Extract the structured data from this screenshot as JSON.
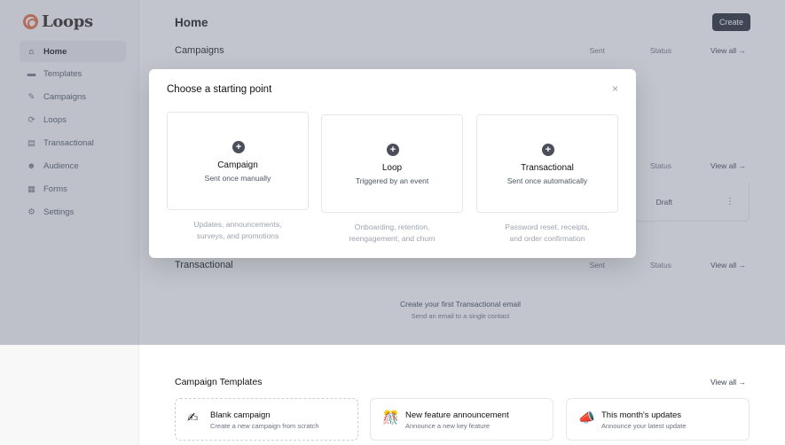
{
  "app": {
    "name": "Loops"
  },
  "sidebar": {
    "items": [
      {
        "label": "Home",
        "icon": "home-icon",
        "glyph": "⌂"
      },
      {
        "label": "Templates",
        "icon": "templates-icon",
        "glyph": "▬"
      },
      {
        "label": "Campaigns",
        "icon": "campaigns-icon",
        "glyph": "✎"
      },
      {
        "label": "Loops",
        "icon": "loops-icon",
        "glyph": "⟳"
      },
      {
        "label": "Transactional",
        "icon": "transactional-icon",
        "glyph": "▤"
      },
      {
        "label": "Audience",
        "icon": "audience-icon",
        "glyph": "☻"
      },
      {
        "label": "Forms",
        "icon": "forms-icon",
        "glyph": "▦"
      },
      {
        "label": "Settings",
        "icon": "settings-icon",
        "glyph": "⚙"
      }
    ]
  },
  "header": {
    "title": "Home",
    "create_label": "Create"
  },
  "sections": {
    "campaigns": {
      "title": "Campaigns",
      "sent": "Sent",
      "status": "Status",
      "view_all": "View all →"
    },
    "loops": {
      "status": "Status",
      "view_all": "View all →",
      "row_status": "Draft",
      "row_menu": "⋮"
    },
    "transactional": {
      "title": "Transactional",
      "sent": "Sent",
      "status": "Status",
      "view_all": "View all →",
      "empty_title": "Create your first Transactional email",
      "empty_sub": "Send an email to a single contact"
    }
  },
  "templates": {
    "title": "Campaign Templates",
    "view_all": "View all →",
    "cards": [
      {
        "title": "Blank campaign",
        "desc": "Create a new campaign from scratch",
        "icon": "writing-hand-icon",
        "glyph": "✍"
      },
      {
        "title": "New feature announcement",
        "desc": "Announce a new key feature",
        "icon": "party-popper-icon",
        "glyph": "🎊"
      },
      {
        "title": "This month's updates",
        "desc": "Announce your latest update",
        "icon": "megaphone-icon",
        "glyph": "📣"
      }
    ]
  },
  "modal": {
    "title": "Choose a starting point",
    "close": "×",
    "plus": "+",
    "choices": [
      {
        "name": "Campaign",
        "sub": "Sent once manually",
        "desc_1": "Updates, announcements,",
        "desc_2": "surveys, and promotions"
      },
      {
        "name": "Loop",
        "sub": "Triggered by an event",
        "desc_1": "Onboarding, retention,",
        "desc_2": "reengagement, and churn"
      },
      {
        "name": "Transactional",
        "sub": "Sent once automatically",
        "desc_1": "Password reset, receipts,",
        "desc_2": "and order confirmation"
      }
    ]
  },
  "colors": {
    "brand": "#e56a3a",
    "button": "#1f2430",
    "overlay": "#6e7587"
  }
}
